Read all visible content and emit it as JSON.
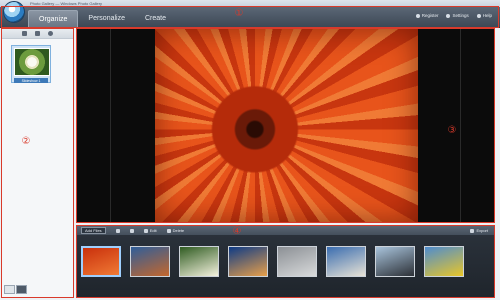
{
  "window": {
    "title": "Photo Gallery — Windows Photo Gallery"
  },
  "header": {
    "tabs": [
      {
        "label": "Organize",
        "active": true
      },
      {
        "label": "Personalize",
        "active": false
      },
      {
        "label": "Create",
        "active": false
      }
    ],
    "links": [
      {
        "label": "Register",
        "icon": "pencil-icon"
      },
      {
        "label": "Settings",
        "icon": "gear-icon"
      },
      {
        "label": "Help",
        "icon": "help-icon"
      }
    ]
  },
  "callouts": [
    "①",
    "②",
    "③",
    "④"
  ],
  "left_panel": {
    "album_label": "Slideshow 1"
  },
  "strip_toolbar": {
    "sort_label": "Add Files",
    "items": [
      {
        "label": "",
        "icon": "rotate-left-icon"
      },
      {
        "label": "",
        "icon": "rotate-right-icon"
      },
      {
        "label": "Edit",
        "icon": "edit-icon"
      },
      {
        "label": "Delete",
        "icon": "delete-icon"
      }
    ],
    "export_label": "Export"
  },
  "filmstrip": {
    "thumbs": [
      {
        "name": "red-flower",
        "colors": [
          "#c9300c",
          "#f07a35"
        ],
        "selected": true
      },
      {
        "name": "canyon",
        "colors": [
          "#2f5e9a",
          "#c4672d"
        ],
        "selected": false
      },
      {
        "name": "green-flower",
        "colors": [
          "#305c22",
          "#f4f2de"
        ],
        "selected": false
      },
      {
        "name": "jellyfish",
        "colors": [
          "#0e3b86",
          "#e8a04a"
        ],
        "selected": false
      },
      {
        "name": "koala",
        "colors": [
          "#8c9095",
          "#d8dadb"
        ],
        "selected": false
      },
      {
        "name": "house",
        "colors": [
          "#3a6db0",
          "#e8e3d5"
        ],
        "selected": false
      },
      {
        "name": "penguins",
        "colors": [
          "#a9c4dc",
          "#2c3036"
        ],
        "selected": false
      },
      {
        "name": "tulips",
        "colors": [
          "#4e8ccf",
          "#e8c629"
        ],
        "selected": false
      }
    ]
  }
}
